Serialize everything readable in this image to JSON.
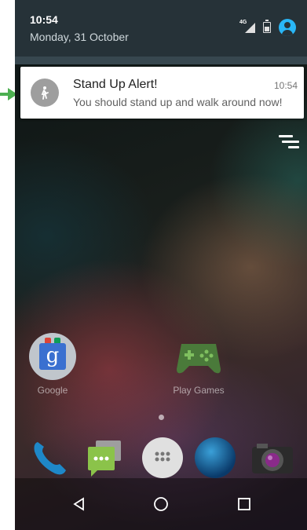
{
  "status_bar": {
    "time": "10:54",
    "date": "Monday, 31 October",
    "network_label": "4G",
    "icons": [
      "signal-icon",
      "battery-icon",
      "account-icon"
    ]
  },
  "notification": {
    "title": "Stand Up Alert!",
    "time": "10:54",
    "text": "You should stand up and walk around now!",
    "icon": "walking-person-icon",
    "accent_color": "#9e9e9e"
  },
  "annotation": {
    "arrow_color": "#4caf50"
  },
  "home_screen": {
    "apps": [
      {
        "label": "Google",
        "icon": "google-folder-icon"
      },
      {
        "label": "Play Games",
        "icon": "play-games-icon"
      }
    ],
    "dock": [
      "phone-icon",
      "messenger-icon",
      "app-drawer-icon",
      "browser-icon",
      "camera-icon"
    ]
  },
  "nav_bar": {
    "buttons": [
      "back-icon",
      "home-icon",
      "recents-icon"
    ]
  }
}
